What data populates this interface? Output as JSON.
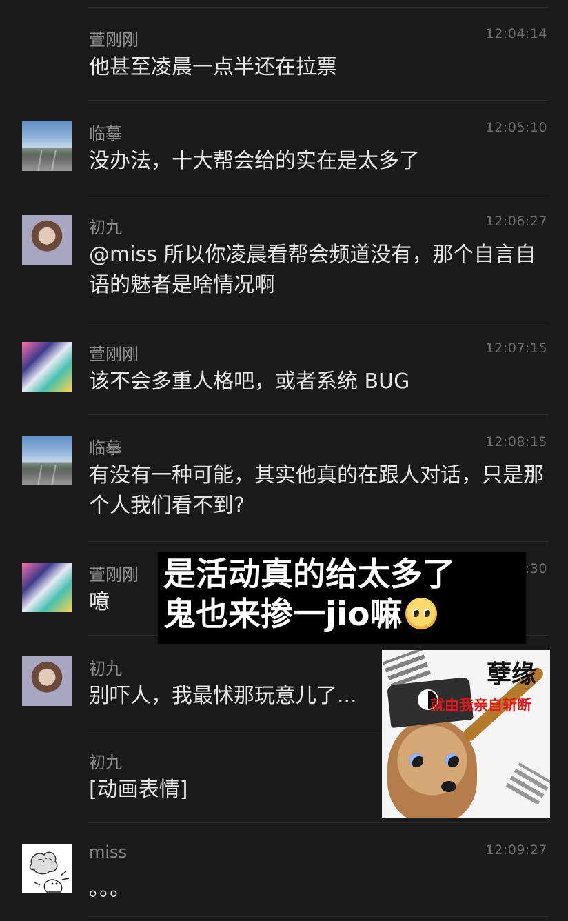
{
  "messages": [
    {
      "name": "萱刚刚",
      "time": "12:04:14",
      "text": "他甚至凌晨一点半还在拉票",
      "avatar": "none"
    },
    {
      "name": "临摹",
      "time": "12:05:10",
      "text": "没办法，十大帮会给的实在是太多了",
      "avatar": "road-landscape"
    },
    {
      "name": "初九",
      "time": "12:06:27",
      "text": "@miss 所以你凌晨看帮会频道没有，那个自言自语的魅者是啥情况啊",
      "avatar": "girl-portrait"
    },
    {
      "name": "萱刚刚",
      "time": "12:07:15",
      "text": "该不会多重人格吧，或者系统 BUG",
      "avatar": "anime-art"
    },
    {
      "name": "临摹",
      "time": "12:08:15",
      "text": "有没有一种可能，其实他真的在跟人对话，只是那个人我们看不到?",
      "avatar": "road-landscape"
    },
    {
      "name": "萱刚刚",
      "time": ":30",
      "text": "噫",
      "avatar": "anime-art"
    },
    {
      "name": "初九",
      "time": "",
      "text": "别吓人，我最怵那玩意儿了...",
      "avatar": "girl-portrait"
    },
    {
      "name": "初九",
      "time": "",
      "text": "[动画表情]",
      "avatar": "none"
    },
    {
      "name": "miss",
      "time": "12:09:27",
      "text": "。。。",
      "avatar": "brain-doodle"
    }
  ],
  "overlay_caption": {
    "line1": "是活动真的给太多了",
    "line2": "鬼也来掺一jio嘛",
    "emoji": "pleading-face-emoji"
  },
  "sticker": {
    "title": "孽缘",
    "subtitle": "就由我亲自斩断"
  }
}
